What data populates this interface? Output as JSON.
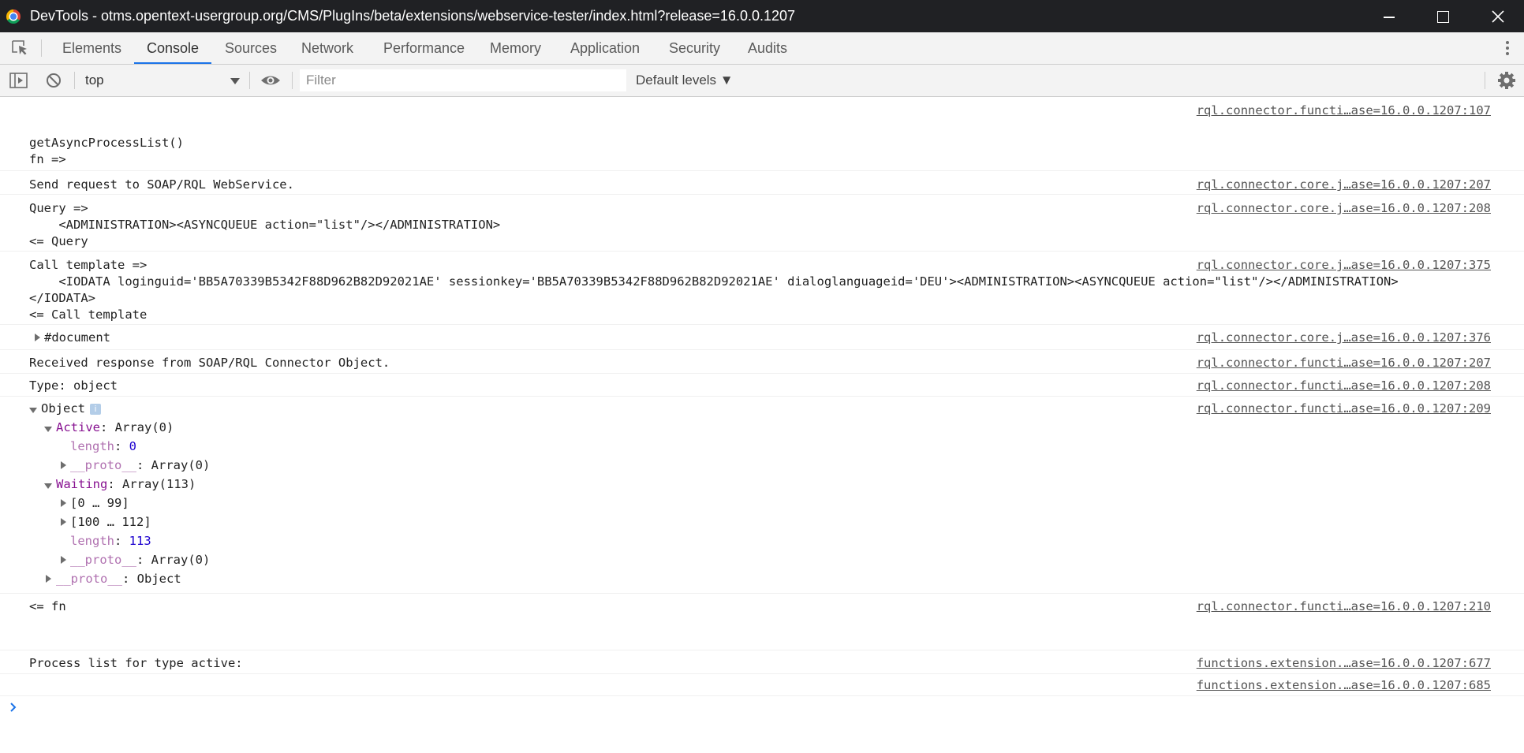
{
  "window": {
    "title": "DevTools - otms.opentext-usergroup.org/CMS/PlugIns/beta/extensions/webservice-tester/index.html?release=16.0.0.1207"
  },
  "tabs": [
    "Elements",
    "Console",
    "Sources",
    "Network",
    "Performance",
    "Memory",
    "Application",
    "Security",
    "Audits"
  ],
  "active_tab": "Console",
  "toolbar": {
    "context": "top",
    "filter_placeholder": "Filter",
    "levels": "Default levels ▼"
  },
  "console": {
    "entries": [
      {
        "src": "rql.connector.functi…ase=16.0.0.1207:107",
        "lines": [
          "",
          "getAsyncProcessList()",
          "fn =>"
        ]
      },
      {
        "src": "rql.connector.core.j…ase=16.0.0.1207:207",
        "lines": [
          "Send request to SOAP/RQL WebService."
        ]
      },
      {
        "src": "rql.connector.core.j…ase=16.0.0.1207:208",
        "lines": [
          "Query =>",
          "    <ADMINISTRATION><ASYNCQUEUE action=\"list\"/></ADMINISTRATION>",
          "<= Query"
        ]
      },
      {
        "src": "rql.connector.core.j…ase=16.0.0.1207:375",
        "lines": [
          "Call template =>",
          "    <IODATA loginguid='BB5A70339B5342F88D962B82D92021AE' sessionkey='BB5A70339B5342F88D962B82D92021AE' dialoglanguageid='DEU'><ADMINISTRATION><ASYNCQUEUE action=\"list\"/></ADMINISTRATION>",
          "</IODATA>",
          "<= Call template"
        ]
      },
      {
        "src": "rql.connector.core.j…ase=16.0.0.1207:376",
        "lines": [
          "#document"
        ]
      },
      {
        "src": "rql.connector.functi…ase=16.0.0.1207:207",
        "lines": [
          "Received response from SOAP/RQL Connector Object."
        ]
      },
      {
        "src": "rql.connector.functi…ase=16.0.0.1207:208",
        "lines": [
          "Type: object"
        ]
      },
      {
        "src": "rql.connector.functi…ase=16.0.0.1207:209",
        "lines": [
          "Object"
        ]
      },
      {
        "src": "rql.connector.functi…ase=16.0.0.1207:210",
        "lines": [
          "<= fn"
        ]
      },
      {
        "src": "functions.extension.…ase=16.0.0.1207:677",
        "lines": [
          "Process list for type active:"
        ]
      },
      {
        "src": "functions.extension.…ase=16.0.0.1207:685",
        "lines": [
          ""
        ]
      }
    ],
    "object_tree": {
      "active_key": "Active",
      "active_val": ": Array(0)",
      "length_key": "length",
      "active_length": "0",
      "proto_key": "__proto__",
      "proto_array": ": Array(0)",
      "waiting_key": "Waiting",
      "waiting_val": ": Array(113)",
      "range1": "[0 … 99]",
      "range2": "[100 … 112]",
      "waiting_length": "113",
      "proto_object": ": Object",
      "info": "i"
    }
  },
  "colors": {
    "accent": "#1a73e8",
    "titlebar": "#202124",
    "property_key": "#881391",
    "number": "#1c00cf"
  }
}
